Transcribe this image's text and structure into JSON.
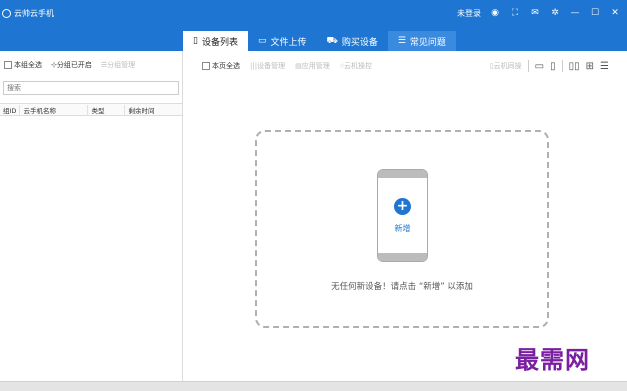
{
  "app": {
    "title": "云帅云手机"
  },
  "titlebar": {
    "login_status": "未登录"
  },
  "tabs": [
    {
      "label": "设备列表"
    },
    {
      "label": "文件上传"
    },
    {
      "label": "购买设备"
    },
    {
      "label": "常见问题"
    }
  ],
  "left_panel": {
    "select_all": "本组全选",
    "groups_open": "分组已开启",
    "group_manage": "分组管理",
    "search_placeholder": "搜索",
    "columns": [
      "组ID",
      "云手机名称",
      "类型",
      "剩余时间"
    ]
  },
  "right_panel": {
    "select_page": "本页全选",
    "device_manage": "设备管理",
    "app_manage": "应用管理",
    "cloud_control": "云机操控",
    "cloud_sync": "云机同操"
  },
  "empty_state": {
    "add_label": "新增",
    "message": "无任何新设备！请点击 “新增” 以添加"
  },
  "watermark": "最需网",
  "colors": {
    "primary": "#1e76d2",
    "watermark": "#7a1fa0"
  }
}
